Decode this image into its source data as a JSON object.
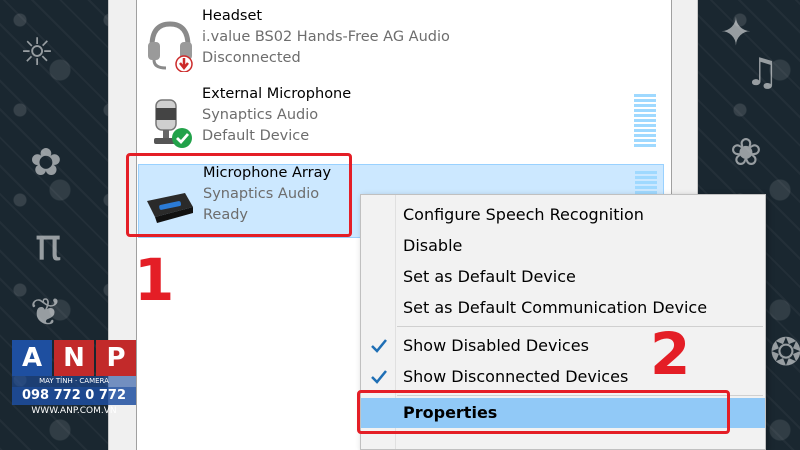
{
  "devices": [
    {
      "name": "Headset",
      "line2": "i.value BS02 Hands-Free AG Audio",
      "line3": "Disconnected",
      "icon": "headset-icon"
    },
    {
      "name": "External Microphone",
      "line2": "Synaptics Audio",
      "line3": "Default Device",
      "icon": "microphone-icon"
    },
    {
      "name": "Microphone Array",
      "line2": "Synaptics Audio",
      "line3": "Ready",
      "icon": "microphone-array-icon"
    }
  ],
  "context_menu": {
    "items": [
      {
        "label": "Configure Speech Recognition",
        "checked": false
      },
      {
        "label": "Disable",
        "checked": false
      },
      {
        "label": "Set as Default Device",
        "checked": false
      },
      {
        "label": "Set as Default Communication Device",
        "checked": false
      },
      {
        "label": "Show Disabled Devices",
        "checked": true
      },
      {
        "label": "Show Disconnected Devices",
        "checked": true
      },
      {
        "label": "Properties",
        "checked": false,
        "highlighted": true
      }
    ]
  },
  "annotations": {
    "step1": "1",
    "step2": "2"
  },
  "watermark": {
    "letters": [
      "A",
      "N",
      "P"
    ],
    "tagline": "MAY TÍNH · CAMERA",
    "phone": "098 772 0 772",
    "site": "WWW.ANP.COM.VN"
  },
  "colors": {
    "annotation_red": "#e41e26",
    "selection_blue": "#cce8ff",
    "menu_highlight": "#91c9f7",
    "check_blue": "#1f6fb5"
  }
}
